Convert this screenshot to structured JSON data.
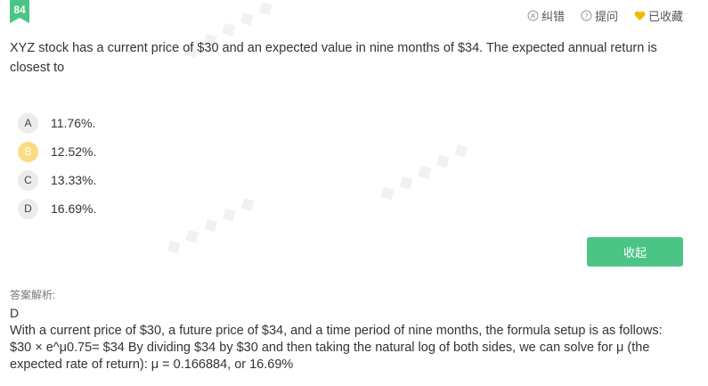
{
  "question": {
    "number": "84",
    "text": "XYZ stock has a current price of $30 and an expected value in nine months of $34. The expected annual return is closest to"
  },
  "toolbar": {
    "report_label": "纠错",
    "ask_label": "提问",
    "favorite_label": "已收藏"
  },
  "options": [
    {
      "letter": "A",
      "text": "11.76%."
    },
    {
      "letter": "B",
      "text": "12.52%."
    },
    {
      "letter": "C",
      "text": "13.33%."
    },
    {
      "letter": "D",
      "text": "16.69%."
    }
  ],
  "selected_option": "B",
  "collapse_label": "收起",
  "analysis": {
    "label": "答案解析:",
    "answer": "D",
    "explanation": "With a current price of $30, a future price of $34, and a time period of nine months, the formula setup is as follows: $30 × e^μ0.75= $34 By dividing $34 by $30 and then taking the natural log of both sides, we can solve for μ (the expected rate of return): μ = 0.166884, or 16.69%"
  },
  "colors": {
    "accent_green": "#4cc486",
    "selected_yellow": "#f9dc83",
    "heart_yellow": "#f5b800"
  }
}
